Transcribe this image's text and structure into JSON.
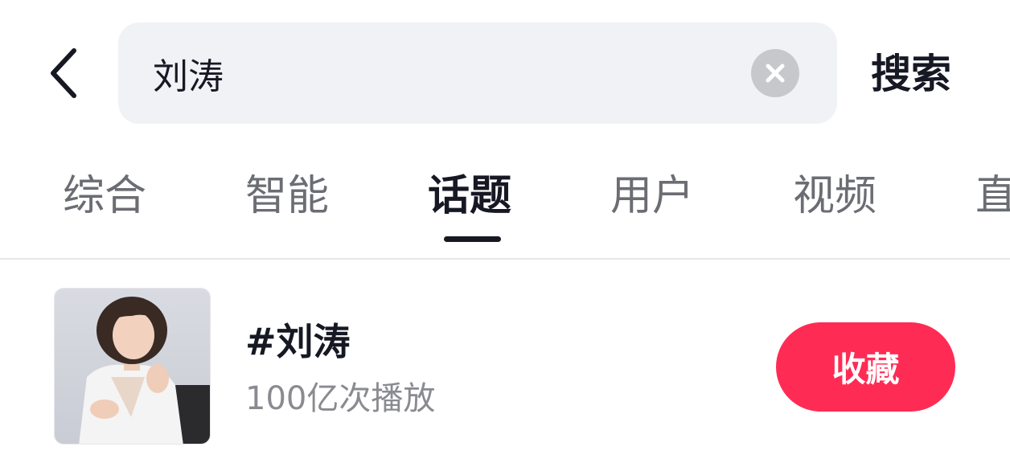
{
  "header": {
    "search": {
      "value": "刘涛",
      "placeholder": ""
    },
    "search_button_label": "搜索"
  },
  "tabs": [
    {
      "label": "综合",
      "active": false
    },
    {
      "label": "智能",
      "active": false
    },
    {
      "label": "话题",
      "active": true
    },
    {
      "label": "用户",
      "active": false
    },
    {
      "label": "视频",
      "active": false
    },
    {
      "label": "直",
      "active": false
    }
  ],
  "result": {
    "title": "#刘涛",
    "plays": "100亿次播放",
    "action_label": "收藏"
  },
  "icons": {
    "back": "chevron-left-icon",
    "clear": "close-circle-icon"
  },
  "colors": {
    "accent": "#fe2c55",
    "text_primary": "#161823",
    "text_secondary": "#8a8b91",
    "search_bg": "#f1f2f6"
  }
}
